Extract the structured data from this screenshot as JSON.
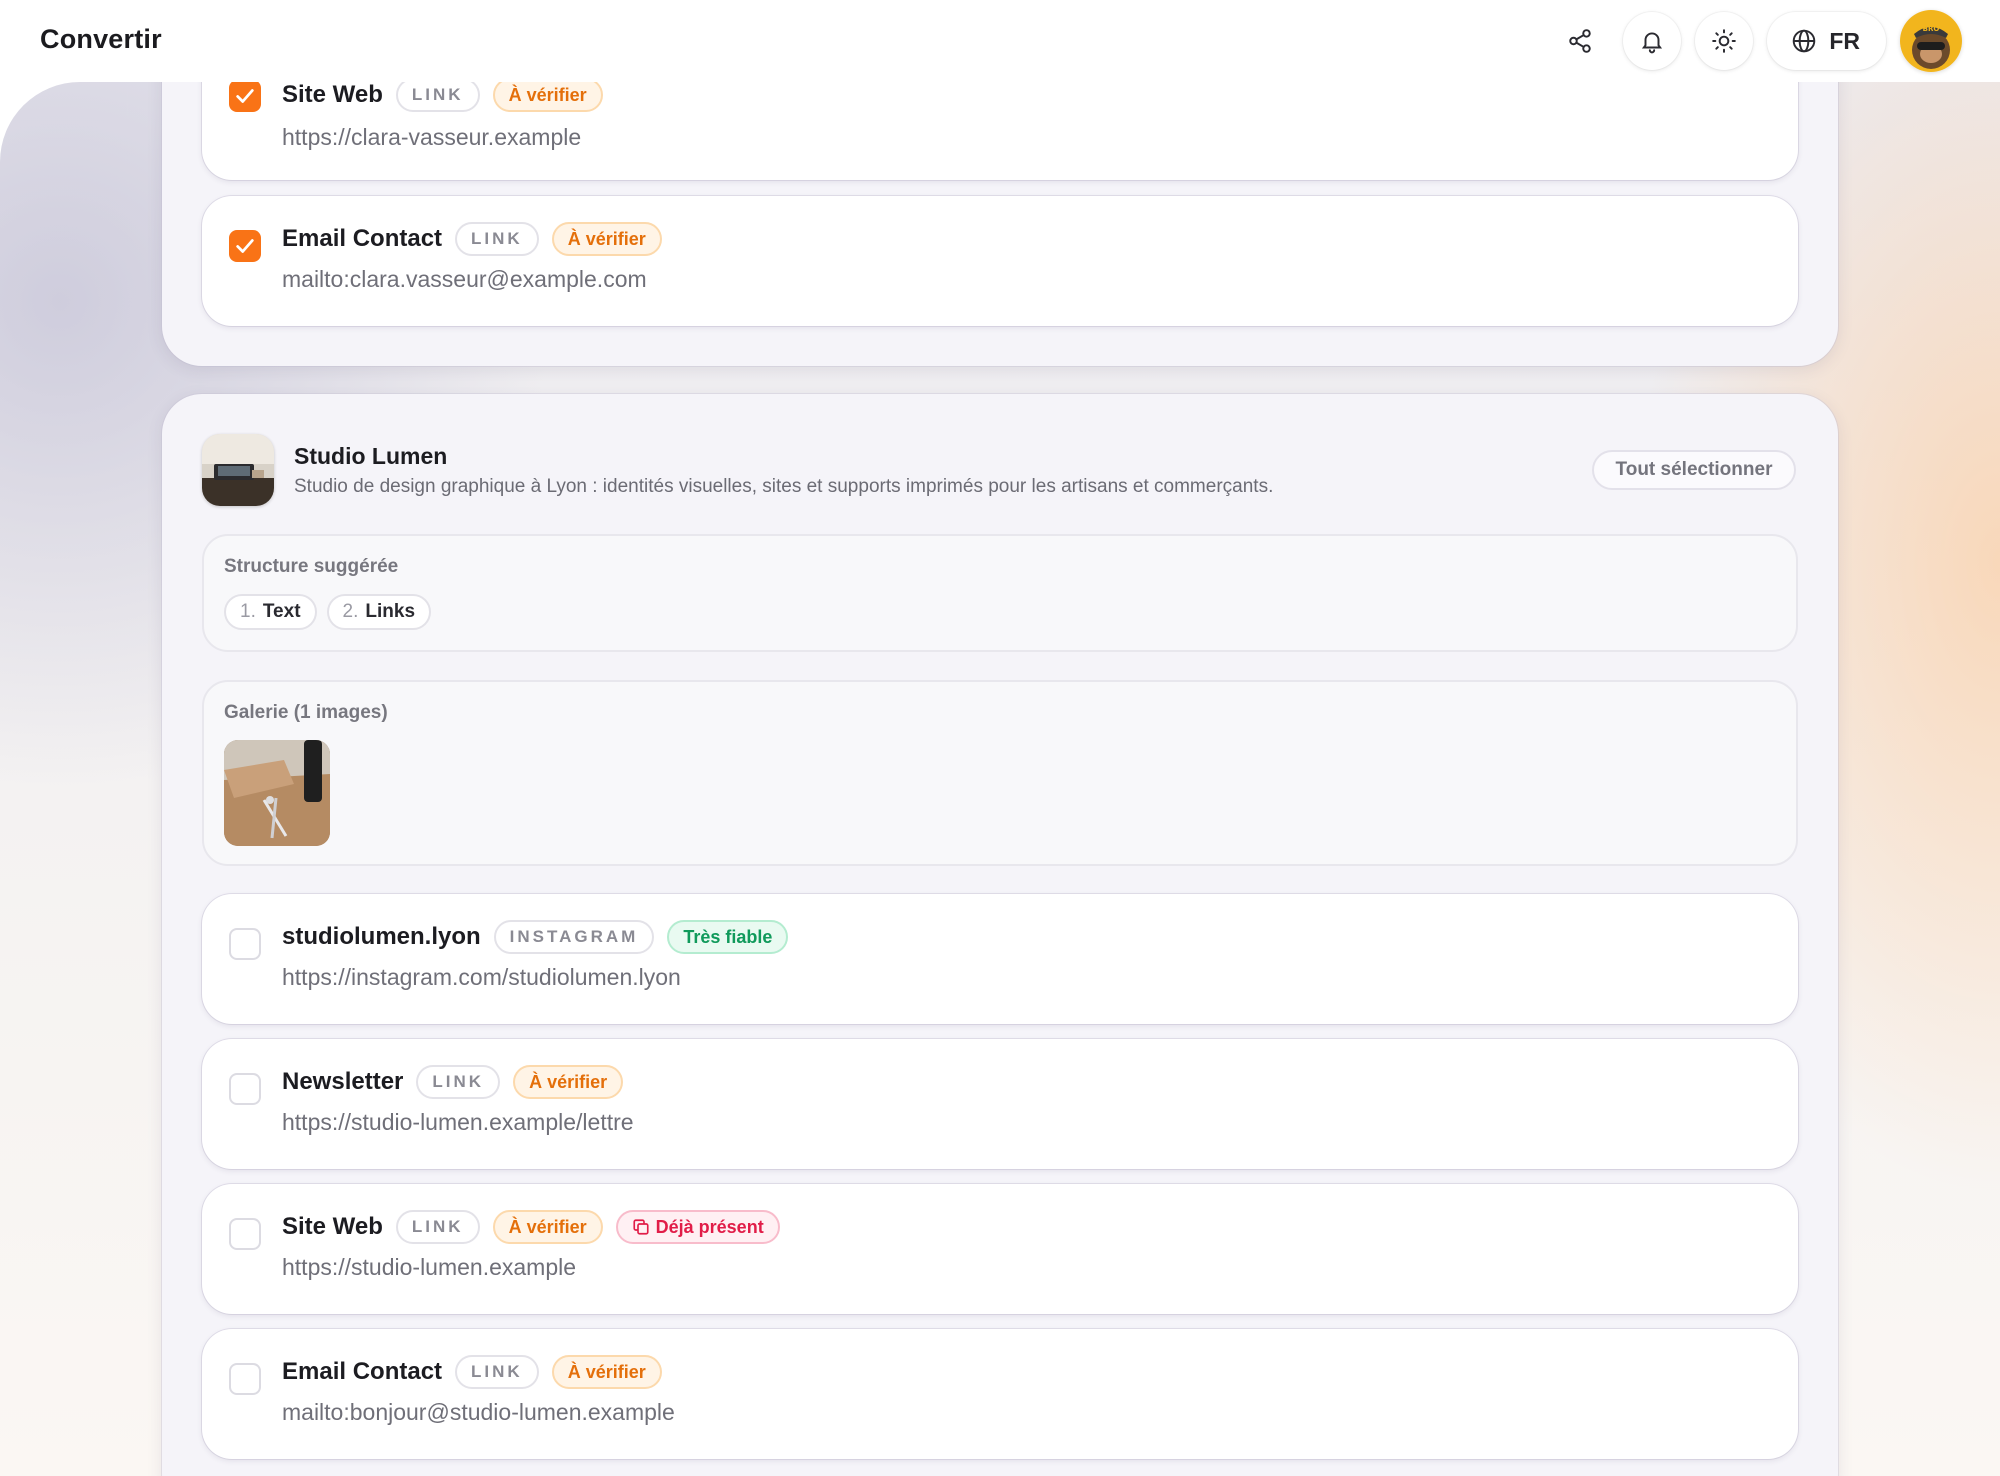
{
  "app": {
    "title": "Convertir"
  },
  "topbar": {
    "language": "FR",
    "icons": [
      "share-icon",
      "bell-icon",
      "sun-icon",
      "globe-icon"
    ],
    "avatar_text": "BRO"
  },
  "top_group": {
    "items": [
      {
        "title": "Site Web",
        "type": "LINK",
        "status": "À vérifier",
        "url": "https://clara-vasseur.example",
        "checked": true
      },
      {
        "title": "Email Contact",
        "type": "LINK",
        "status": "À vérifier",
        "url": "mailto:clara.vasseur@example.com",
        "checked": true
      }
    ]
  },
  "studio": {
    "name": "Studio Lumen",
    "description": "Studio de design graphique à Lyon : identités visuelles, sites et supports imprimés pour les artisans et commerçants.",
    "select_all_label": "Tout sélectionner",
    "structure": {
      "title": "Structure suggérée",
      "steps": [
        {
          "num": "1.",
          "label": "Text"
        },
        {
          "num": "2.",
          "label": "Links"
        }
      ]
    },
    "gallery": {
      "title": "Galerie (1 images)"
    },
    "items": [
      {
        "title": "studiolumen.lyon",
        "type": "INSTAGRAM",
        "status": "Très fiable",
        "url": "https://instagram.com/studiolumen.lyon",
        "checked": false
      },
      {
        "title": "Newsletter",
        "type": "LINK",
        "status": "À vérifier",
        "url": "https://studio-lumen.example/lettre",
        "checked": false
      },
      {
        "title": "Site Web",
        "type": "LINK",
        "status": "À vérifier",
        "duplicate": "Déjà présent",
        "url": "https://studio-lumen.example",
        "checked": false
      },
      {
        "title": "Email Contact",
        "type": "LINK",
        "status": "À vérifier",
        "url": "mailto:bonjour@studio-lumen.example",
        "checked": false
      }
    ]
  },
  "colors": {
    "accent": "#f97316",
    "verify": "#e46f0a",
    "trust": "#109a5b",
    "duplicate": "#e11d48"
  }
}
